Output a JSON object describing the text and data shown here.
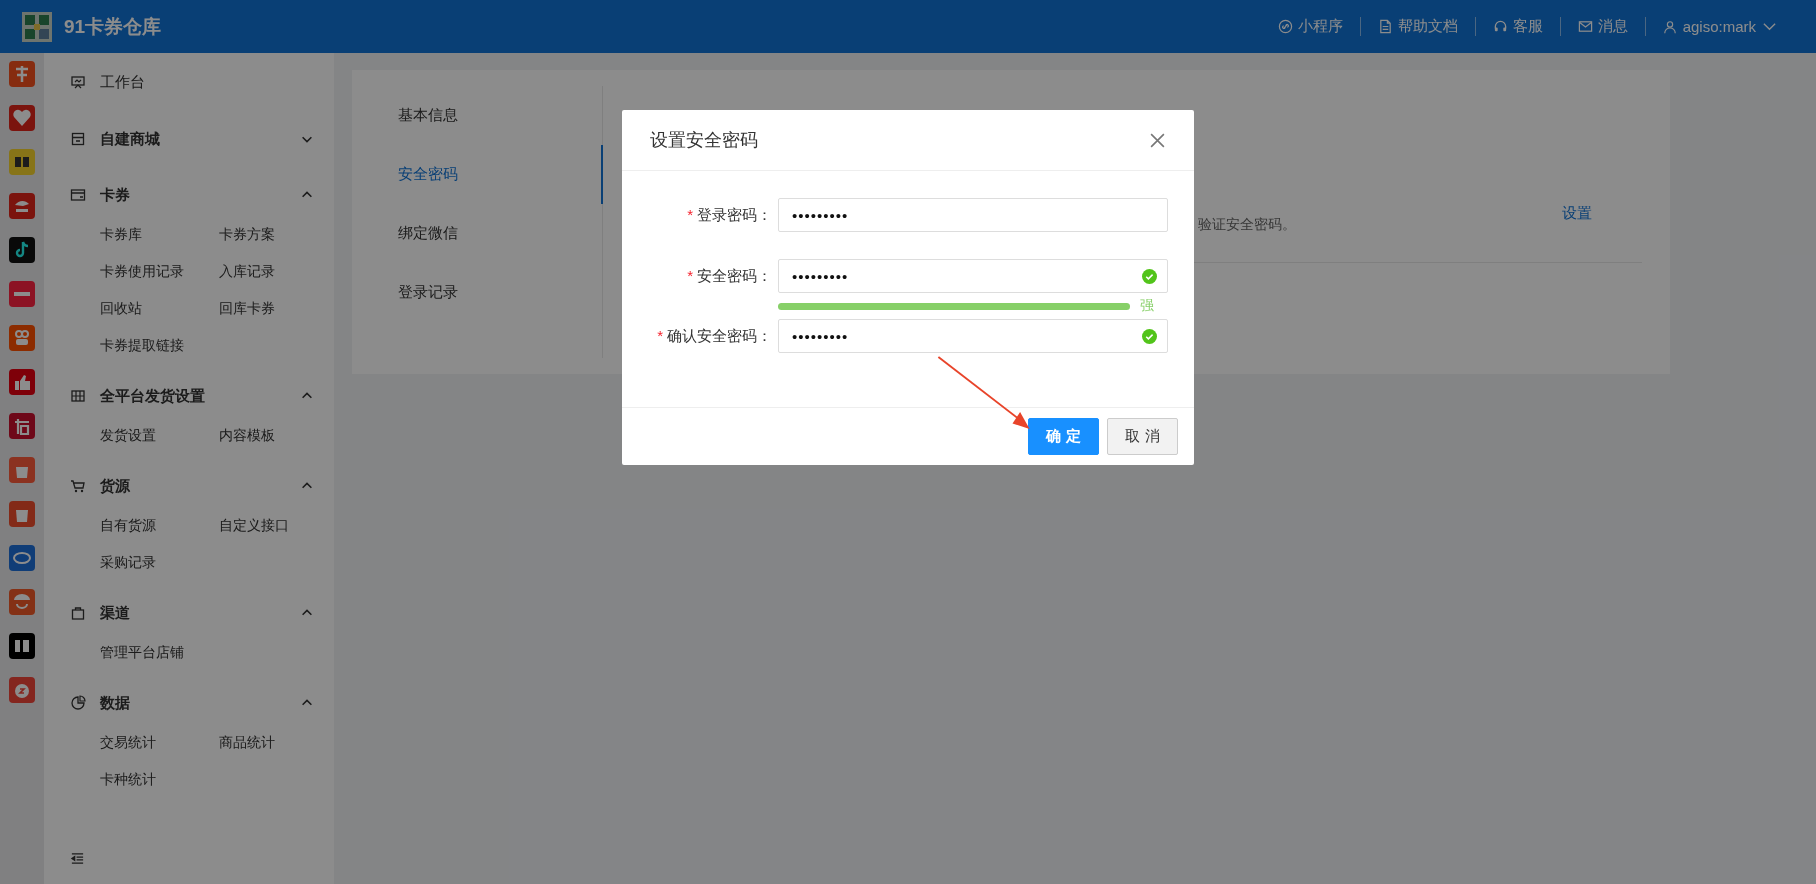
{
  "header": {
    "title": "91卡券仓库",
    "links": [
      {
        "label": "小程序"
      },
      {
        "label": "帮助文档"
      },
      {
        "label": "客服"
      },
      {
        "label": "消息"
      }
    ],
    "user": "agiso:mark"
  },
  "menu": [
    {
      "title": "工作台"
    },
    {
      "title": "自建商城",
      "expanded": false
    },
    {
      "title": "卡券",
      "expanded": true,
      "children": [
        "卡券库",
        "卡券方案",
        "卡券使用记录",
        "入库记录",
        "回收站",
        "回库卡券",
        "卡券提取链接"
      ]
    },
    {
      "title": "全平台发货设置",
      "expanded": true,
      "children": [
        "发货设置",
        "内容模板"
      ]
    },
    {
      "title": "货源",
      "expanded": true,
      "children": [
        "自有货源",
        "自定义接口",
        "采购记录"
      ]
    },
    {
      "title": "渠道",
      "expanded": true,
      "children": [
        "管理平台店铺"
      ]
    },
    {
      "title": "数据",
      "expanded": true,
      "children": [
        "交易统计",
        "商品统计",
        "卡种统计"
      ]
    }
  ],
  "settings": {
    "tabs": [
      {
        "label": "基本信息",
        "selected": false
      },
      {
        "label": "安全密码",
        "selected": true
      },
      {
        "label": "绑定微信",
        "selected": false
      },
      {
        "label": "登录记录",
        "selected": false
      }
    ],
    "hint": "验证安全密码。",
    "action": "设置"
  },
  "dialog": {
    "title": "设置安全密码",
    "fields": [
      {
        "required_mark": "*",
        "label": "登录密码：",
        "value": "•••••••••",
        "valid": false
      },
      {
        "required_mark": "*",
        "label": "安全密码：",
        "value": "•••••••••",
        "valid": true
      },
      {
        "required_mark": "*",
        "label": "确认安全密码：",
        "value": "•••••••••",
        "valid": true
      }
    ],
    "strength": {
      "level": 1,
      "label": "强"
    },
    "buttons": [
      {
        "label": "确 定",
        "kind": "primary"
      },
      {
        "label": "取 消",
        "kind": "default"
      }
    ]
  }
}
